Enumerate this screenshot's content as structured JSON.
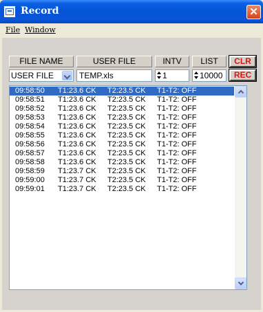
{
  "window": {
    "title": "Record",
    "close_symbol": "✕"
  },
  "menu": [
    {
      "label": "File"
    },
    {
      "label": "Window"
    }
  ],
  "toolbar": {
    "file_name_header": "FILE NAME",
    "user_file_header": "USER FILE",
    "intv_header": "INTV",
    "list_header": "LIST",
    "clr_label": "CLR",
    "rec_label": "REC",
    "file_select_value": "USER FILE",
    "user_file_value": "TEMP.xls",
    "intv_value": "1",
    "list_value": "10000"
  },
  "records": [
    {
      "time": "09:58:50",
      "t1": "T1:23.6 CK",
      "t2": "T2:23.5 CK",
      "diff": "T1-T2: OFF",
      "selected": true
    },
    {
      "time": "09:58:51",
      "t1": "T1:23.6 CK",
      "t2": "T2:23.5 CK",
      "diff": "T1-T2: OFF"
    },
    {
      "time": "09:58:52",
      "t1": "T1:23.6 CK",
      "t2": "T2:23.5 CK",
      "diff": "T1-T2: OFF"
    },
    {
      "time": "09:58:53",
      "t1": "T1:23.6 CK",
      "t2": "T2:23.5 CK",
      "diff": "T1-T2: OFF"
    },
    {
      "time": "09:58:54",
      "t1": "T1:23.6 CK",
      "t2": "T2:23.5 CK",
      "diff": "T1-T2: OFF"
    },
    {
      "time": "09:58:55",
      "t1": "T1:23.6 CK",
      "t2": "T2:23.5 CK",
      "diff": "T1-T2: OFF"
    },
    {
      "time": "09:58:56",
      "t1": "T1:23.6 CK",
      "t2": "T2:23.5 CK",
      "diff": "T1-T2: OFF"
    },
    {
      "time": "09:58:57",
      "t1": "T1:23.6 CK",
      "t2": "T2:23.5 CK",
      "diff": "T1-T2: OFF"
    },
    {
      "time": "09:58:58",
      "t1": "T1:23.6 CK",
      "t2": "T2:23.5 CK",
      "diff": "T1-T2: OFF"
    },
    {
      "time": "09:58:59",
      "t1": "T1:23.7 CK",
      "t2": "T2:23.5 CK",
      "diff": "T1-T2: OFF"
    },
    {
      "time": "09:59:00",
      "t1": "T1:23.7 CK",
      "t2": "T2:23.5 CK",
      "diff": "T1-T2: OFF"
    },
    {
      "time": "09:59:01",
      "t1": "T1:23.7 CK",
      "t2": "T2:23.5 CK",
      "diff": "T1-T2: OFF"
    }
  ],
  "colors": {
    "accent": "#316ac5",
    "alert": "#e01010",
    "titlebar": "#0554d8"
  }
}
